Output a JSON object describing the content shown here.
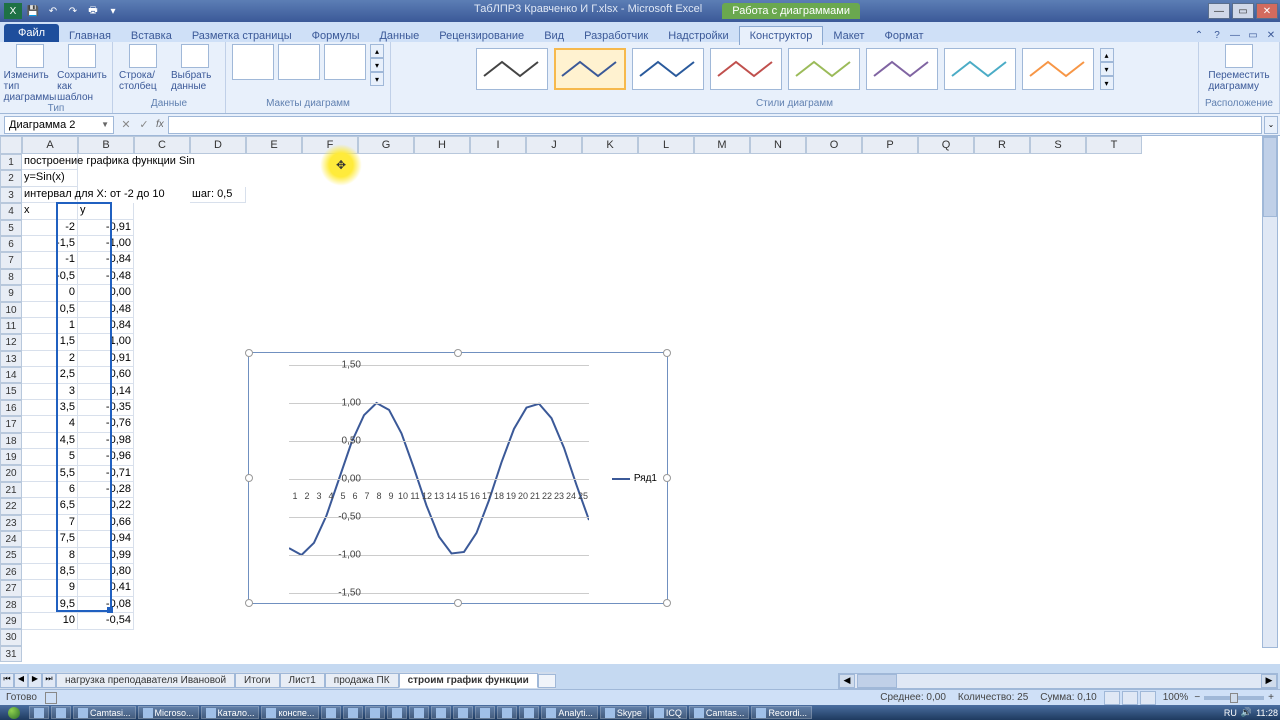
{
  "titlebar": {
    "doc_title": "ТабЛПР3 Кравченко И Г.xlsx - Microsoft Excel",
    "chart_tools_label": "Работа с диаграммами"
  },
  "tabs": {
    "file": "Файл",
    "items": [
      "Главная",
      "Вставка",
      "Разметка страницы",
      "Формулы",
      "Данные",
      "Рецензирование",
      "Вид",
      "Разработчик",
      "Надстройки",
      "Конструктор",
      "Макет",
      "Формат"
    ],
    "active": "Конструктор"
  },
  "ribbon": {
    "group_type": {
      "label": "Тип",
      "btn1": "Изменить тип диаграммы",
      "btn2": "Сохранить как шаблон"
    },
    "group_data": {
      "label": "Данные",
      "btn1": "Строка/столбец",
      "btn2": "Выбрать данные"
    },
    "group_layouts": {
      "label": "Макеты диаграмм"
    },
    "group_styles": {
      "label": "Стили диаграмм"
    },
    "group_loc": {
      "label": "Расположение",
      "btn": "Переместить диаграмму"
    }
  },
  "namebox": "Диаграмма 2",
  "columns": [
    "A",
    "B",
    "C",
    "D",
    "E",
    "F",
    "G",
    "H",
    "I",
    "J",
    "K",
    "L",
    "M",
    "N",
    "O",
    "P",
    "Q",
    "R",
    "S",
    "T"
  ],
  "rows": 31,
  "cells_text": {
    "A1": "построение графика функции Sin",
    "A2": "y=Sin(x)",
    "A3": "интервал для X: от -2 до 10",
    "D3": "шаг: 0,5",
    "A4": "x",
    "B4": "y"
  },
  "table_x": [
    "-2",
    "-1,5",
    "-1",
    "-0,5",
    "0",
    "0,5",
    "1",
    "1,5",
    "2",
    "2,5",
    "3",
    "3,5",
    "4",
    "4,5",
    "5",
    "5,5",
    "6",
    "6,5",
    "7",
    "7,5",
    "8",
    "8,5",
    "9",
    "9,5",
    "10"
  ],
  "table_y": [
    "-0,91",
    "-1,00",
    "-0,84",
    "-0,48",
    "0,00",
    "0,48",
    "0,84",
    "1,00",
    "0,91",
    "0,60",
    "0,14",
    "-0,35",
    "-0,76",
    "-0,98",
    "-0,96",
    "-0,71",
    "-0,28",
    "0,22",
    "0,66",
    "0,94",
    "0,99",
    "0,80",
    "0,41",
    "-0,08",
    "-0,54"
  ],
  "chart_data": {
    "type": "line",
    "y_ticks": [
      "1,50",
      "1,00",
      "0,50",
      "0,00",
      "-0,50",
      "-1,00",
      "-1,50"
    ],
    "x_categories": [
      1,
      2,
      3,
      4,
      5,
      6,
      7,
      8,
      9,
      10,
      11,
      12,
      13,
      14,
      15,
      16,
      17,
      18,
      19,
      20,
      21,
      22,
      23,
      24,
      25
    ],
    "series": [
      {
        "name": "Ряд1",
        "values": [
          -0.91,
          -1.0,
          -0.84,
          -0.48,
          0.0,
          0.48,
          0.84,
          1.0,
          0.91,
          0.6,
          0.14,
          -0.35,
          -0.76,
          -0.98,
          -0.96,
          -0.71,
          -0.28,
          0.22,
          0.66,
          0.94,
          0.99,
          0.8,
          0.41,
          -0.08,
          -0.54
        ]
      }
    ],
    "ylim": [
      -1.5,
      1.5
    ]
  },
  "sheets": [
    "нагрузка преподавателя Ивановой",
    "Итоги",
    "Лист1",
    "продажа ПК",
    "строим график функции"
  ],
  "active_sheet": "строим график функции",
  "status": {
    "ready": "Готово",
    "avg": "Среднее: 0,00",
    "count": "Количество: 25",
    "sum": "Сумма: 0,10",
    "zoom": "100%"
  },
  "taskbar": {
    "items": [
      "Camtasi...",
      "Microso...",
      "Катало...",
      "конспе...",
      "",
      "",
      "",
      "",
      "",
      "",
      "",
      "",
      "",
      "",
      "Analyti...",
      "Skype",
      "ICQ",
      "Camtas...",
      "Recordi..."
    ],
    "lang": "RU",
    "time": "11:28"
  }
}
